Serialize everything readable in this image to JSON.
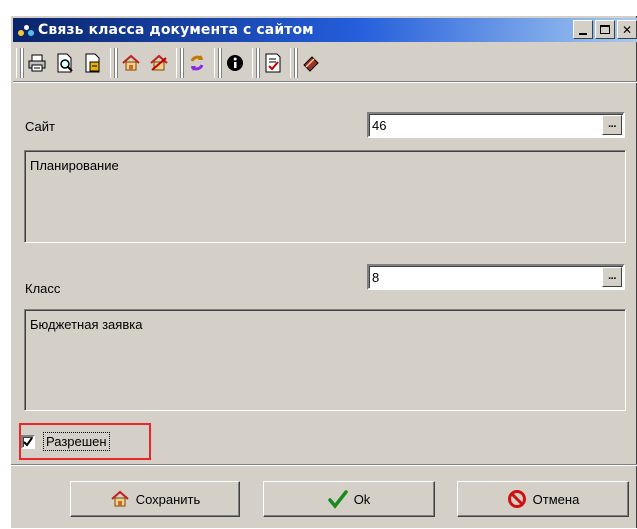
{
  "window": {
    "title": "Связь класса документа с сайтом",
    "minimize": "_",
    "maximize": "□",
    "close": "✕"
  },
  "toolbar": {
    "icons": [
      "print-icon",
      "print-preview-icon",
      "export-icon",
      "home-add-icon",
      "home-remove-icon",
      "refresh-icon",
      "info-icon",
      "document-check-icon",
      "book-icon"
    ]
  },
  "form": {
    "site_label": "Сайт",
    "site_value": "46",
    "site_name": "Планирование",
    "class_label": "Класс",
    "class_value": "8",
    "class_name": "Бюджетная заявка",
    "ellipsis": "···",
    "allowed_label": "Разрешен",
    "allowed_checked": true
  },
  "buttons": {
    "save": "Сохранить",
    "ok": "Ok",
    "cancel": "Отмена"
  },
  "colors": {
    "window_bg": "#d4d0c8",
    "titlebar": "#0a246a",
    "highlight": "#e8262c"
  }
}
